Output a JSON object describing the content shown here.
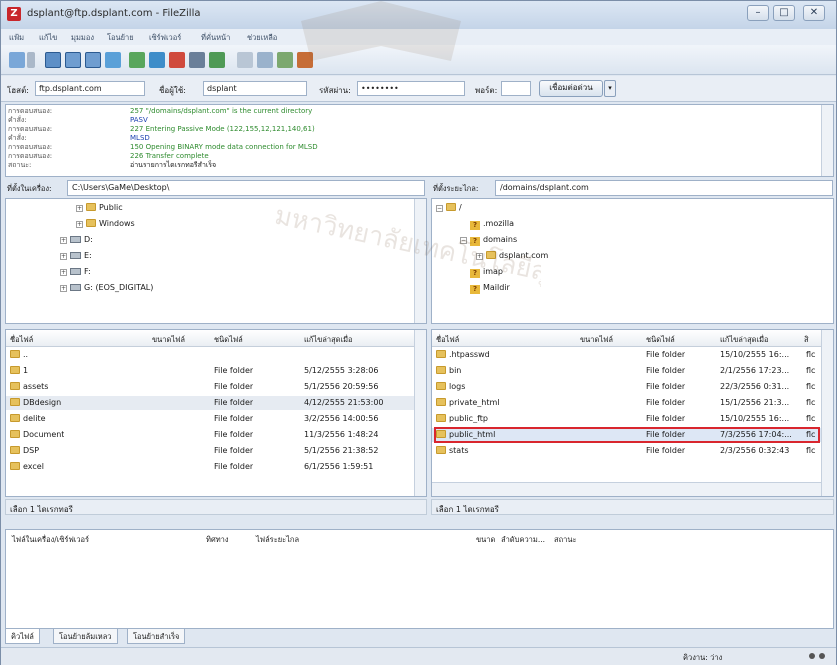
{
  "window": {
    "title": "dsplant@ftp.dsplant.com - FileZilla",
    "controls": {
      "minimize": "–",
      "maximize": "□",
      "close": "✕"
    }
  },
  "menubar": [
    "แฟ้ม",
    "แก้ไข",
    "มุมมอง",
    "โอนย้าย",
    "เซิร์ฟเวอร์",
    "ที่คั่นหน้า",
    "ช่วยเหลือ"
  ],
  "toolbar": {
    "icons": [
      "site-manager-icon",
      "dropdown-icon",
      "message-log-icon",
      "local-tree-icon",
      "remote-tree-icon",
      "queue-icon",
      "refresh-icon",
      "process-queue-icon",
      "cancel-icon",
      "disconnect-icon",
      "reconnect-icon",
      "filter-icon",
      "compare-icon",
      "sync-browse-icon",
      "search-icon"
    ]
  },
  "quickconnect": {
    "host_label": "โฮสต์:",
    "host_value": "ftp.dsplant.com",
    "user_label": "ชื่อผู้ใช้:",
    "user_value": "dsplant",
    "pass_label": "รหัสผ่าน:",
    "pass_value": "••••••••",
    "port_label": "พอร์ต:",
    "port_value": "",
    "button": "เชื่อมต่อด่วน",
    "dropdown": "▾"
  },
  "log": [
    {
      "label": "การตอบสนอง:",
      "text": "257 \"/domains/dsplant.com\" is the current directory",
      "color": "#2e8b2e"
    },
    {
      "label": "คำสั่ง:",
      "text": "PASV",
      "color": "#1a3fb0"
    },
    {
      "label": "การตอบสนอง:",
      "text": "227 Entering Passive Mode (122,155,12,121,140,61)",
      "color": "#2e8b2e"
    },
    {
      "label": "คำสั่ง:",
      "text": "MLSD",
      "color": "#1a3fb0"
    },
    {
      "label": "การตอบสนอง:",
      "text": "150 Opening BINARY mode data connection for MLSD",
      "color": "#2e8b2e"
    },
    {
      "label": "การตอบสนอง:",
      "text": "226 Transfer complete",
      "color": "#2e8b2e"
    },
    {
      "label": "สถานะ:",
      "text": "อ่านรายการไดเรกทอรีสำเร็จ",
      "color": "#1a1a1a"
    }
  ],
  "local": {
    "path_label": "ที่ตั้งในเครื่อง:",
    "path_value": "C:\\Users\\GaMe\\Desktop\\",
    "tree": [
      {
        "label": "Public",
        "indent": 2,
        "kind": "folder",
        "exp": "+"
      },
      {
        "label": "Windows",
        "indent": 2,
        "kind": "folder",
        "exp": "+"
      },
      {
        "label": "D:",
        "indent": 1,
        "kind": "drive",
        "exp": "+"
      },
      {
        "label": "E:",
        "indent": 1,
        "kind": "drive",
        "exp": "+"
      },
      {
        "label": "F:",
        "indent": 1,
        "kind": "drive",
        "exp": "+"
      },
      {
        "label": "G: (EOS_DIGITAL)",
        "indent": 1,
        "kind": "drive",
        "exp": "+"
      }
    ],
    "columns": [
      "ชื่อไฟล์",
      "ขนาดไฟล์",
      "ชนิดไฟล์",
      "แก้ไขล่าสุดเมื่อ"
    ],
    "rows": [
      {
        "name": "..",
        "size": "",
        "type": "",
        "modified": ""
      },
      {
        "name": "1",
        "size": "",
        "type": "File folder",
        "modified": "5/12/2555 3:28:06"
      },
      {
        "name": "assets",
        "size": "",
        "type": "File folder",
        "modified": "5/1/2556 20:59:56"
      },
      {
        "name": "DBdesign",
        "size": "",
        "type": "File folder",
        "modified": "4/12/2555 21:53:00"
      },
      {
        "name": "delite",
        "size": "",
        "type": "File folder",
        "modified": "3/2/2556 14:00:56"
      },
      {
        "name": "Document",
        "size": "",
        "type": "File folder",
        "modified": "11/3/2556 1:48:24"
      },
      {
        "name": "DSP",
        "size": "",
        "type": "File folder",
        "modified": "5/1/2556 21:38:52"
      },
      {
        "name": "excel",
        "size": "",
        "type": "File folder",
        "modified": "6/1/2556 1:59:51"
      }
    ],
    "status": "เลือก 1 ไดเรกทอรี"
  },
  "remote": {
    "path_label": "ที่ตั้งระยะไกล:",
    "path_value": "/domains/dsplant.com",
    "tree": [
      {
        "label": "/",
        "indent": 0,
        "kind": "folder",
        "exp": "−"
      },
      {
        "label": ".mozilla",
        "indent": 1,
        "kind": "q",
        "exp": ""
      },
      {
        "label": "domains",
        "indent": 1,
        "kind": "q",
        "exp": "−"
      },
      {
        "label": "dsplant.com",
        "indent": 2,
        "kind": "folder",
        "exp": "+"
      },
      {
        "label": "imap",
        "indent": 1,
        "kind": "q",
        "exp": ""
      },
      {
        "label": "Maildir",
        "indent": 1,
        "kind": "q",
        "exp": ""
      }
    ],
    "columns": [
      "ชื่อไฟล์",
      "ขนาดไฟล์",
      "ชนิดไฟล์",
      "แก้ไขล่าสุดเมื่อ",
      "สิ"
    ],
    "rows": [
      {
        "name": ".htpasswd",
        "size": "",
        "type": "File folder",
        "modified": "15/10/2555 16:...",
        "perm": "flc"
      },
      {
        "name": "bin",
        "size": "",
        "type": "File folder",
        "modified": "2/1/2556 17:23...",
        "perm": "flc"
      },
      {
        "name": "logs",
        "size": "",
        "type": "File folder",
        "modified": "22/3/2556 0:31...",
        "perm": "flc"
      },
      {
        "name": "private_html",
        "size": "",
        "type": "File folder",
        "modified": "15/1/2556 21:3...",
        "perm": "flc"
      },
      {
        "name": "public_ftp",
        "size": "",
        "type": "File folder",
        "modified": "15/10/2555 16:...",
        "perm": "flc"
      },
      {
        "name": "public_html",
        "size": "",
        "type": "File folder",
        "modified": "7/3/2556 17:04:...",
        "perm": "flc"
      },
      {
        "name": "stats",
        "size": "",
        "type": "File folder",
        "modified": "2/3/2556 0:32:43",
        "perm": "flc"
      }
    ],
    "status": "เลือก 1 ไดเรกทอรี",
    "highlighted_row": "public_html"
  },
  "queue": {
    "columns": [
      "ไฟล์ในเครื่อง/เซิร์ฟเวอร์",
      "ทิศทาง",
      "ไฟล์ระยะไกล",
      "ขนาด",
      "ลำดับความ...",
      "สถานะ"
    ]
  },
  "tabs": [
    "คิวไฟล์",
    "โอนย้ายล้มเหลว",
    "โอนย้ายสำเร็จ"
  ],
  "statusbar": {
    "queue_label": "คิวงาน: ว่าง"
  },
  "watermark": {
    "text": "มหาวิทยาลัยเทคโนโลยีสุรนารี"
  },
  "colors": {
    "highlight": "#d9262e",
    "selection": "#dde7f5",
    "accent": "#c8262b"
  }
}
